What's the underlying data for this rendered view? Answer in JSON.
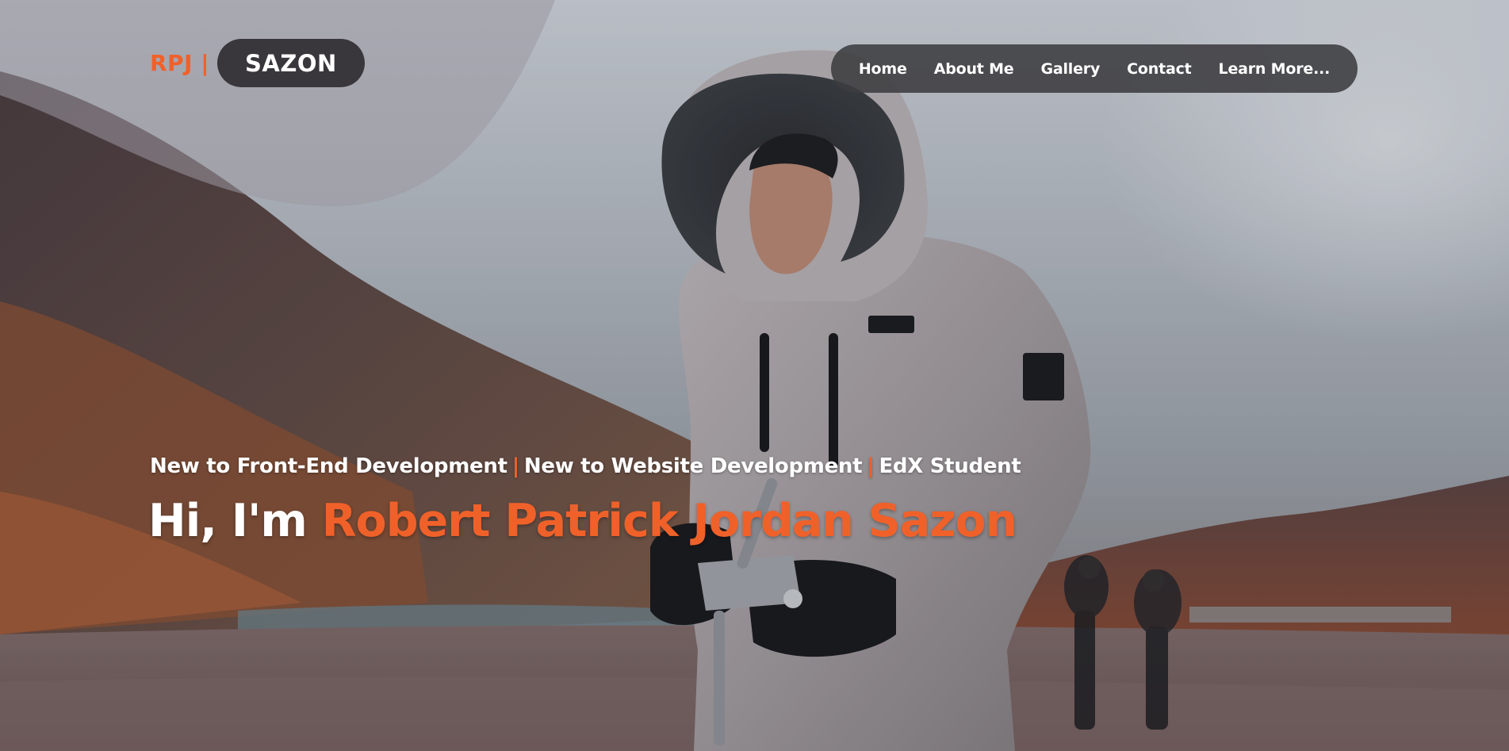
{
  "brand": {
    "prefix": "RPJ |",
    "name": "SAZON"
  },
  "nav": {
    "items": [
      {
        "label": "Home"
      },
      {
        "label": "About Me"
      },
      {
        "label": "Gallery"
      },
      {
        "label": "Contact"
      },
      {
        "label": "Learn More..."
      }
    ]
  },
  "hero": {
    "tagline": {
      "part1": "New to Front-End Development",
      "part2": "New to Website Development",
      "part3": "EdX Student",
      "separator": "|"
    },
    "greeting": "Hi, I'm",
    "name": "Robert Patrick Jordan Sazon"
  },
  "colors": {
    "accent": "#f0612a",
    "pill_bg": "#302e32",
    "text": "#ffffff"
  }
}
